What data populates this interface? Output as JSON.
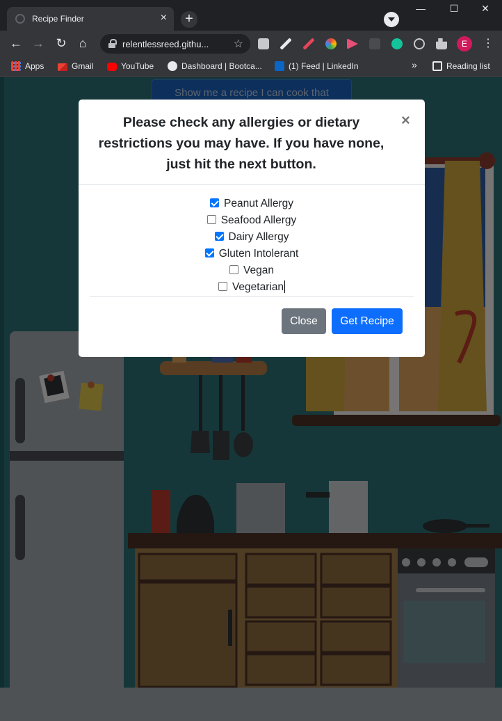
{
  "browser": {
    "tab_title": "Recipe Finder",
    "tab_close": "×",
    "new_tab": "+",
    "url": "relentlessreed.githu...",
    "avatar_letter": "E",
    "window_controls": {
      "minimize": "—",
      "maximize": "☐",
      "close": "✕"
    },
    "nav": {
      "back": "←",
      "forward": "→",
      "reload": "↻",
      "home": "⌂"
    },
    "star": "☆",
    "menu": "⋮",
    "bookmarks": [
      {
        "label": "Apps",
        "icon": "apps-grid-icon"
      },
      {
        "label": "Gmail",
        "icon": "gmail-icon"
      },
      {
        "label": "YouTube",
        "icon": "youtube-icon"
      },
      {
        "label": "Dashboard | Bootca...",
        "icon": "globe-icon"
      },
      {
        "label": "(1) Feed | LinkedIn",
        "icon": "linkedin-icon"
      }
    ],
    "bookmarks_overflow": "»",
    "reading_list": "Reading list"
  },
  "page": {
    "background_button": "Show me a recipe I can cook that",
    "modal": {
      "title": "Please check any allergies or dietary restrictions you may have. If you have none, just hit the next button.",
      "close_symbol": "×",
      "options": [
        {
          "label": "Peanut Allergy",
          "checked": true
        },
        {
          "label": "Seafood Allergy",
          "checked": false
        },
        {
          "label": "Dairy Allergy",
          "checked": true
        },
        {
          "label": "Gluten Intolerant",
          "checked": true
        },
        {
          "label": "Vegan",
          "checked": false
        },
        {
          "label": "Vegetarian",
          "checked": false
        }
      ],
      "close_button": "Close",
      "get_recipe_button": "Get Recipe"
    }
  },
  "colors": {
    "primary": "#0d6efd",
    "secondary": "#6c757d",
    "checkbox_checked": "#0075ff",
    "wall": "#2b6e73",
    "chrome_dark": "#202124",
    "chrome_toolbar": "#35363a"
  }
}
